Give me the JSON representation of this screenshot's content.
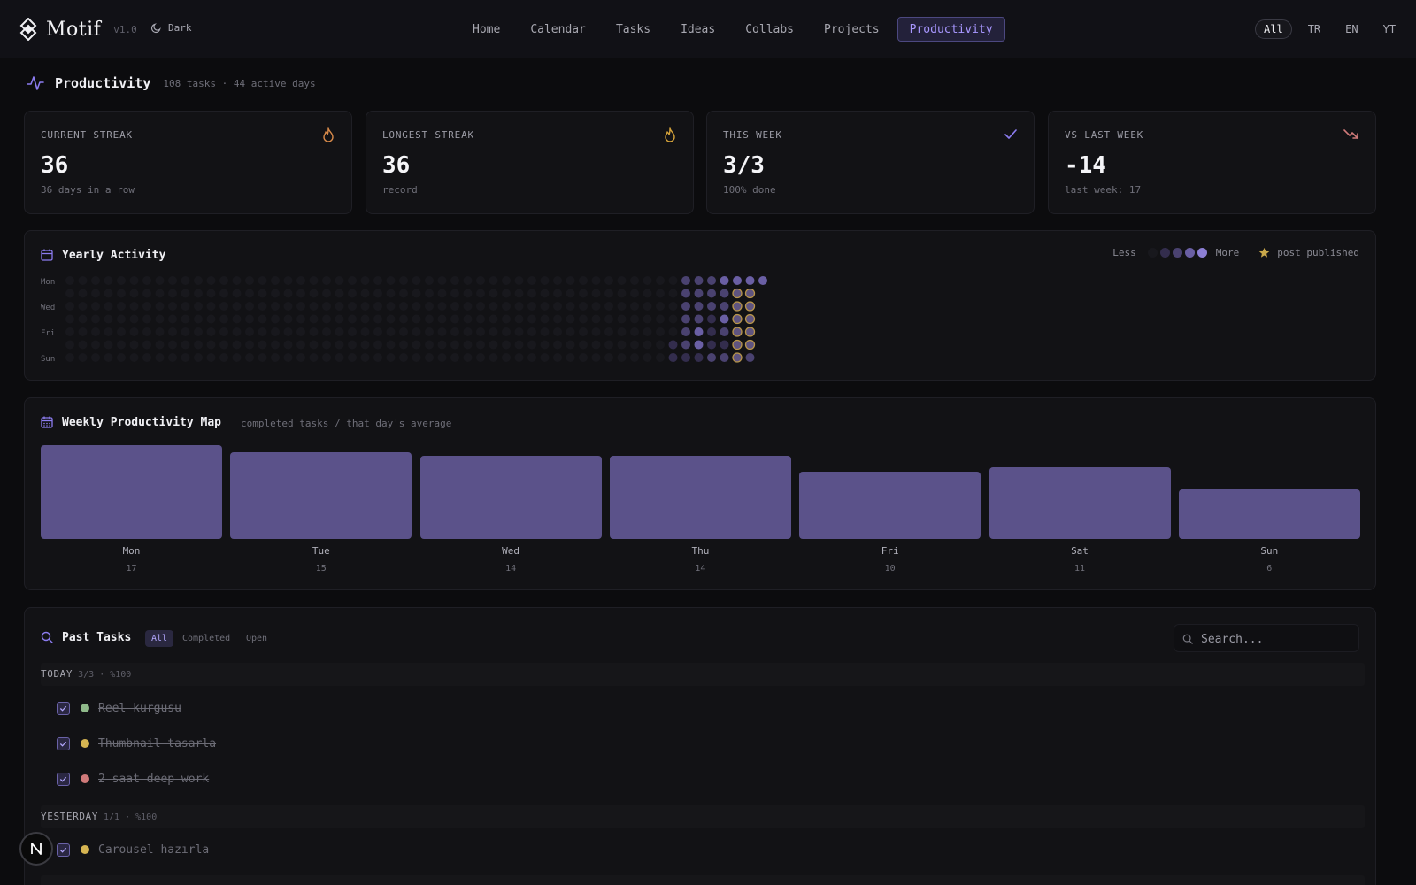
{
  "header": {
    "brand": "Motif",
    "version": "v1.0",
    "theme_label": "Dark",
    "nav": [
      "Home",
      "Calendar",
      "Tasks",
      "Ideas",
      "Collabs",
      "Projects",
      "Productivity"
    ],
    "active_nav": "Productivity",
    "languages": [
      "All",
      "TR",
      "EN",
      "YT"
    ],
    "active_language": "All"
  },
  "page": {
    "title": "Productivity",
    "subtitle": "108 tasks · 44 active days"
  },
  "stats": [
    {
      "label": "CURRENT STREAK",
      "value": "36",
      "sub": "36 days in a row",
      "icon": "flame-icon",
      "color": "#d88a4a"
    },
    {
      "label": "LONGEST STREAK",
      "value": "36",
      "sub": "record",
      "icon": "flame-icon",
      "color": "#d4a23a"
    },
    {
      "label": "THIS WEEK",
      "value": "3/3",
      "sub": "100% done",
      "icon": "check-icon",
      "color": "#8c7cf0"
    },
    {
      "label": "VS LAST WEEK",
      "value": "-14",
      "sub": "last week: 17",
      "icon": "trend-down-icon",
      "color": "#d07a7a"
    }
  ],
  "yearly": {
    "title": "Yearly Activity",
    "legend_less": "Less",
    "legend_more": "More",
    "legend_post": "post published",
    "day_labels": [
      "Mon",
      "Wed",
      "Fri",
      "Sun"
    ],
    "level_colors": [
      "#18181d",
      "#332d4d",
      "#4a4270",
      "#6a5fa4",
      "#8c7fd4"
    ]
  },
  "weekly": {
    "title": "Weekly Productivity Map",
    "subtitle": "completed tasks / that day's average",
    "chart_data": {
      "type": "bar",
      "categories": [
        "Mon",
        "Tue",
        "Wed",
        "Thu",
        "Fri",
        "Sat",
        "Sun"
      ],
      "values": [
        17,
        15,
        14,
        14,
        10,
        11,
        6
      ],
      "bar_color": "#5b528a"
    }
  },
  "past_tasks": {
    "title": "Past Tasks",
    "filters": [
      "All",
      "Completed",
      "Open"
    ],
    "active_filter": "All",
    "search_placeholder": "Search...",
    "groups": [
      {
        "label": "TODAY",
        "meta": "3/3 · %100",
        "tasks": [
          {
            "text": "Reel kurgusu",
            "color": "#8fb98a"
          },
          {
            "text": "Thumbnail tasarla",
            "color": "#d6b552"
          },
          {
            "text": "2 saat deep work",
            "color": "#d07a7a"
          }
        ]
      },
      {
        "label": "YESTERDAY",
        "meta": "1/1 · %100",
        "tasks": [
          {
            "text": "Carousel hazırla",
            "color": "#d6b552"
          }
        ]
      }
    ]
  }
}
